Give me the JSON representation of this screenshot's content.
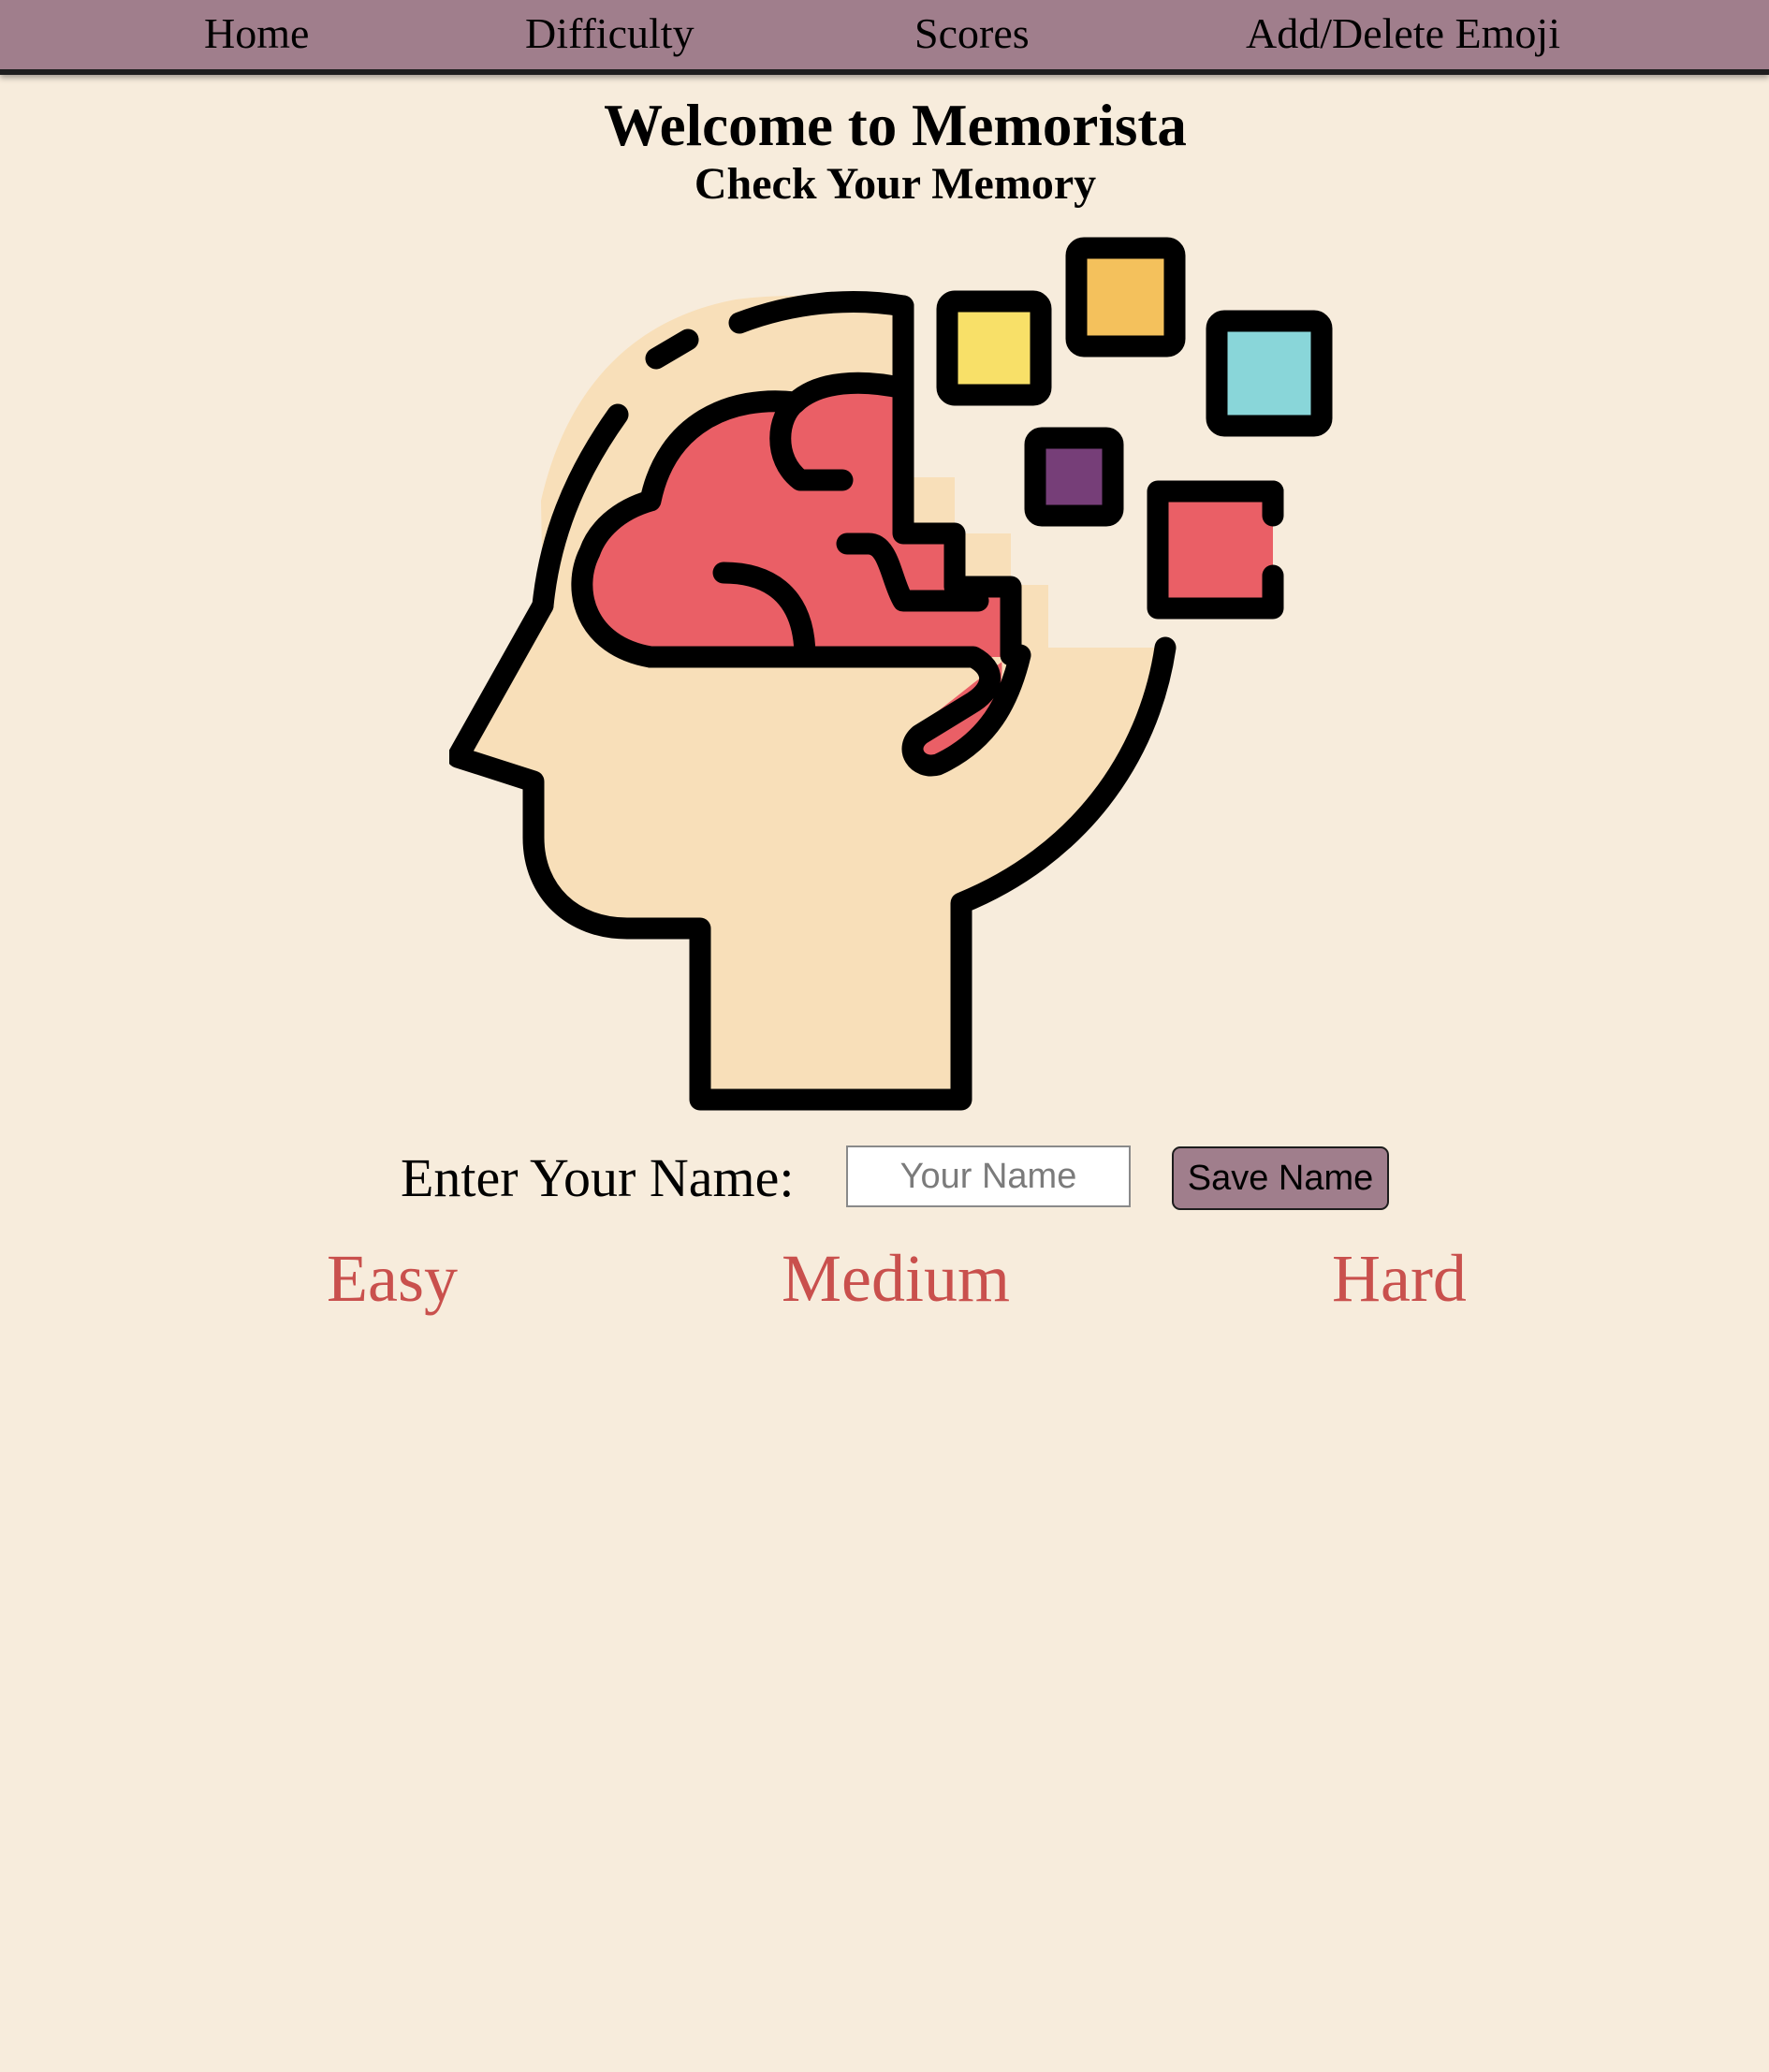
{
  "nav": {
    "items": [
      {
        "label": "Home"
      },
      {
        "label": "Difficulty"
      },
      {
        "label": "Scores"
      },
      {
        "label": "Add/Delete Emoji"
      }
    ]
  },
  "header": {
    "title": "Welcome to Memorista",
    "subtitle": "Check Your Memory"
  },
  "hero": {
    "icon": "memory-head-brain-icon"
  },
  "name_form": {
    "label": "Enter Your Name:",
    "input_value": "",
    "input_placeholder": "Your Name",
    "save_label": "Save Name"
  },
  "difficulty": {
    "options": [
      {
        "label": "Easy"
      },
      {
        "label": "Medium"
      },
      {
        "label": "Hard"
      }
    ]
  },
  "colors": {
    "background": "#f7ecdc",
    "navbar": "#a07e8c",
    "difficulty_text": "#c9504d",
    "head_fill": "#f8dfb9",
    "brain_fill": "#ea5f66",
    "square_yellow": "#f8e068",
    "square_orange": "#f4c15c",
    "square_teal": "#89d6d9",
    "square_purple": "#763e78",
    "square_red": "#ea5f66"
  }
}
